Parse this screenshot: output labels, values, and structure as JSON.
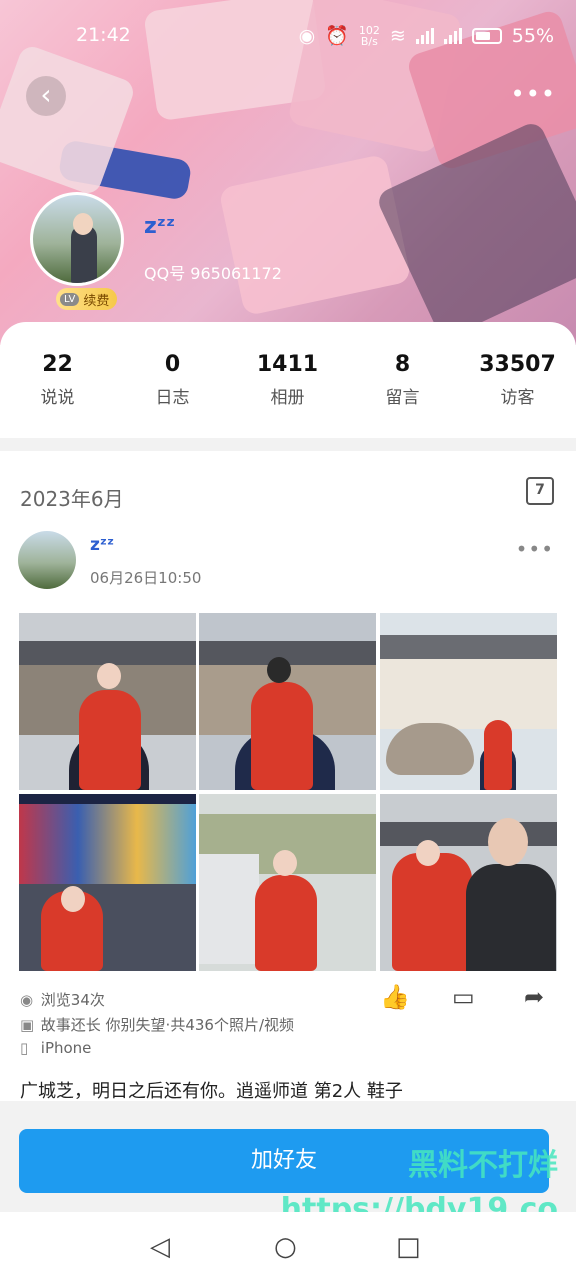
{
  "status_bar": {
    "time": "21:42",
    "net_speed_top": "102",
    "net_speed_bottom": "B/s",
    "battery": "55%"
  },
  "profile": {
    "nickname": "zᶻᶻ",
    "qq_label": "QQ号 965061172",
    "vip_level": "LV",
    "vip_renew": "续费"
  },
  "stats": [
    {
      "num": "22",
      "label": "说说"
    },
    {
      "num": "0",
      "label": "日志"
    },
    {
      "num": "1411",
      "label": "相册"
    },
    {
      "num": "8",
      "label": "留言"
    },
    {
      "num": "33507",
      "label": "访客"
    }
  ],
  "feed": {
    "month": "2023年6月",
    "calendar_day": "7",
    "post": {
      "nickname": "zᶻᶻ",
      "time": "06月26日10:50",
      "views": "浏览34次",
      "album": "故事还长 你别失望·共436个照片/视频",
      "device": "iPhone",
      "text": "广城芝，明日之后还有你。逍遥师道 第2人 鞋子"
    }
  },
  "buttons": {
    "add_friend": "加好友"
  },
  "watermark": {
    "line1": "黑料不打烊",
    "line2": "https://bdy19.co"
  },
  "icons": {
    "back": "chevron-left-icon",
    "more": "more-icon",
    "calendar": "calendar-icon",
    "like": "thumb-up-icon",
    "comment": "comment-icon",
    "share": "share-icon",
    "nav_back": "triangle-back-icon",
    "nav_home": "circle-home-icon",
    "nav_recent": "square-recent-icon"
  }
}
